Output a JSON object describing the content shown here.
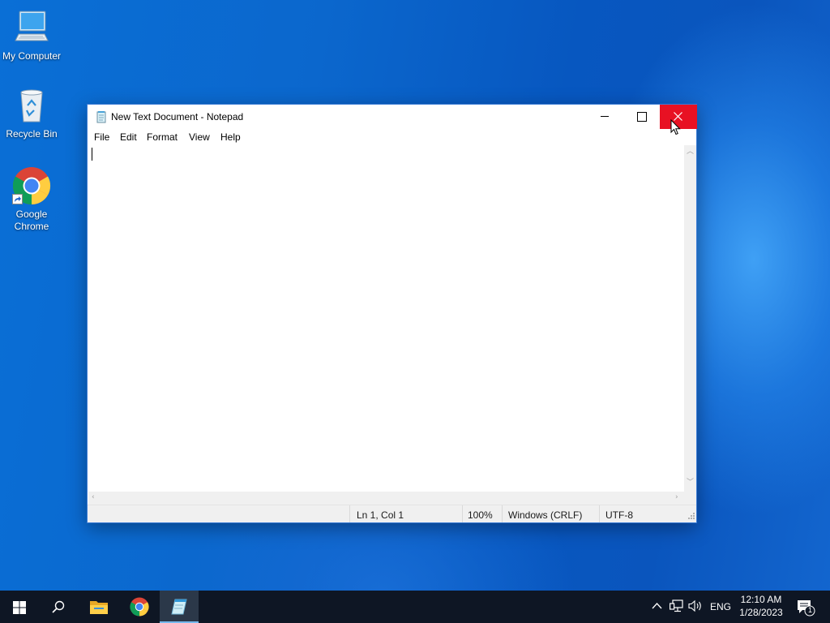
{
  "desktop": {
    "icons": [
      {
        "label": "My Computer",
        "icon": "computer-icon"
      },
      {
        "label": "Recycle Bin",
        "icon": "recycle-bin-icon"
      },
      {
        "label_line1": "Google",
        "label_line2": "Chrome",
        "icon": "chrome-icon"
      }
    ]
  },
  "notepad": {
    "title": "New Text Document - Notepad",
    "menu": [
      "File",
      "Edit",
      "Format",
      "View",
      "Help"
    ],
    "content": "",
    "status": {
      "position": "Ln 1, Col 1",
      "zoom": "100%",
      "line_ending": "Windows (CRLF)",
      "encoding": "UTF-8"
    },
    "close_hover_color": "#e81123"
  },
  "taskbar": {
    "apps": [
      "start-icon",
      "search-icon",
      "file-explorer-icon",
      "chrome-icon",
      "notepad-icon"
    ],
    "active_app": "notepad-icon",
    "tray": {
      "language": "ENG",
      "time": "12:10 AM",
      "date": "1/28/2023",
      "notification_count": "1"
    }
  }
}
